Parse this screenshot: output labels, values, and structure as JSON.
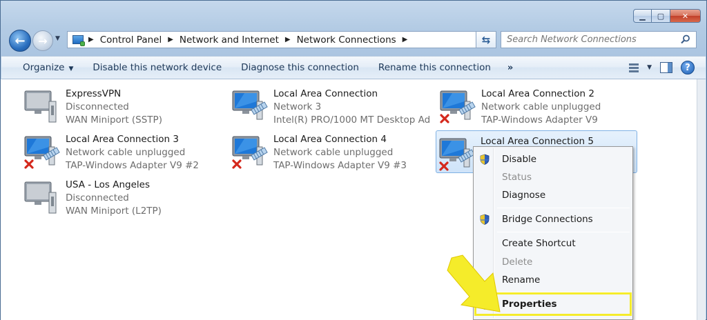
{
  "window": {
    "caption_buttons": [
      "minimize",
      "maximize",
      "close"
    ]
  },
  "address": {
    "breadcrumbs": [
      "Control Panel",
      "Network and Internet",
      "Network Connections"
    ]
  },
  "search": {
    "placeholder": "Search Network Connections"
  },
  "toolbar": {
    "organize": "Organize",
    "disable": "Disable this network device",
    "diagnose": "Diagnose this connection",
    "rename": "Rename this connection",
    "more": "»"
  },
  "connections": [
    {
      "name": "ExpressVPN",
      "status": "Disconnected",
      "device": "WAN Miniport (SSTP)",
      "kind": "wan",
      "unplugged": false
    },
    {
      "name": "Local Area Connection",
      "status": "Network  3",
      "device": "Intel(R) PRO/1000 MT Desktop Ad...",
      "kind": "lan",
      "unplugged": false
    },
    {
      "name": "Local Area Connection 2",
      "status": "Network cable unplugged",
      "device": "TAP-Windows Adapter V9",
      "kind": "lan",
      "unplugged": true
    },
    {
      "name": "Local Area Connection 3",
      "status": "Network cable unplugged",
      "device": "TAP-Windows Adapter V9 #2",
      "kind": "lan",
      "unplugged": true
    },
    {
      "name": "Local Area Connection 4",
      "status": "Network cable unplugged",
      "device": "TAP-Windows Adapter V9 #3",
      "kind": "lan",
      "unplugged": true
    },
    {
      "name": "Local Area Connection 5",
      "status": "",
      "device": "",
      "kind": "lan",
      "unplugged": true,
      "selected": true
    },
    {
      "name": "USA - Los Angeles",
      "status": "Disconnected",
      "device": "WAN Miniport (L2TP)",
      "kind": "wan",
      "unplugged": false
    }
  ],
  "context_menu": {
    "items": [
      {
        "label": "Disable",
        "shield": true,
        "disabled": false
      },
      {
        "label": "Status",
        "shield": false,
        "disabled": true
      },
      {
        "label": "Diagnose",
        "shield": false,
        "disabled": false
      },
      {
        "label": "Bridge Connections",
        "shield": true,
        "disabled": false
      },
      {
        "label": "Create Shortcut",
        "shield": false,
        "disabled": false
      },
      {
        "label": "Delete",
        "shield": false,
        "disabled": true
      },
      {
        "label": "Rename",
        "shield": false,
        "disabled": false
      },
      {
        "label": "Properties",
        "shield": true,
        "disabled": false,
        "bold": true
      }
    ]
  },
  "annotation": {
    "arrow_color": "#f5ec2a",
    "highlight_color": "#f5ec2a"
  }
}
